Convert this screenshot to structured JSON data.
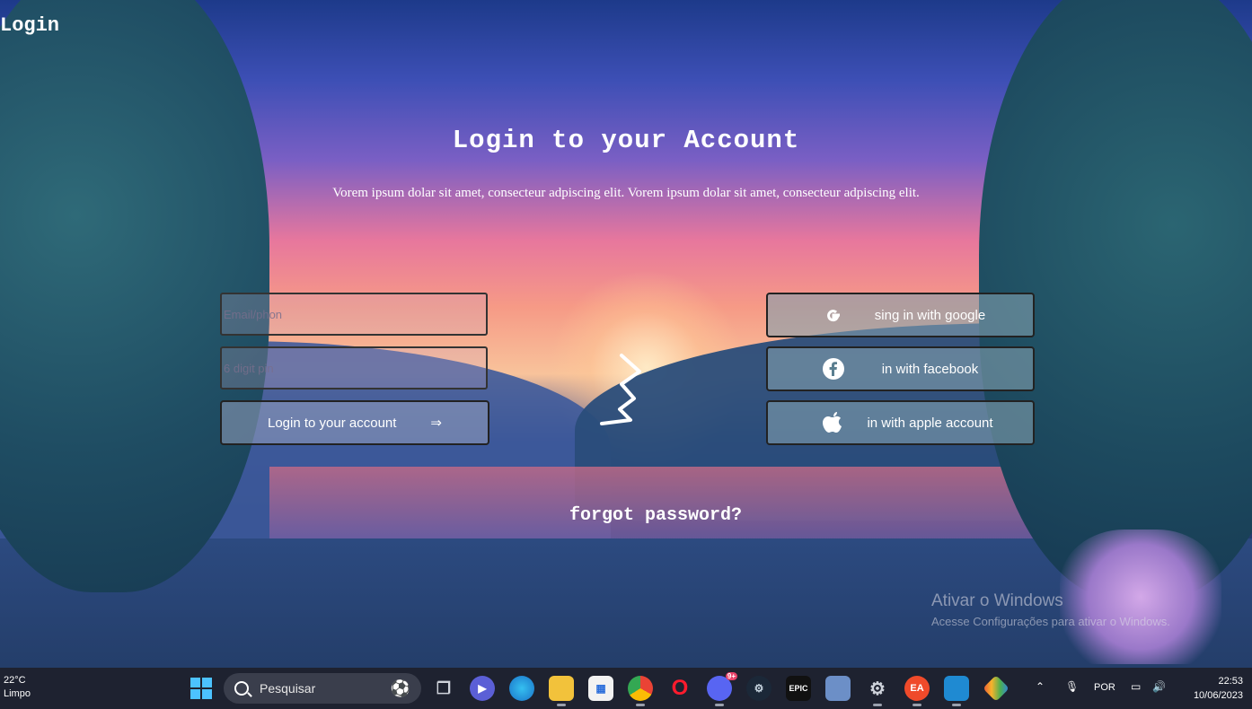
{
  "header": {
    "corner_title": "Login"
  },
  "main": {
    "title": "Login to your Account",
    "subtitle": "Vorem ipsum dolar sit amet, consecteur adpiscing elit. Vorem ipsum dolar sit amet, consecteur adpiscing elit.",
    "email_placeholder": "Email/phon",
    "pin_placeholder": "6 digit pin",
    "login_button_label": "Login to your account",
    "login_arrow": "⇒",
    "forgot_password": "forgot password?"
  },
  "social": {
    "google_label": "sing in with google",
    "facebook_label": "in with facebook",
    "apple_label": "in with apple account"
  },
  "watermark": {
    "line1": "Ativar o Windows",
    "line2": "Acesse Configurações para ativar o Windows."
  },
  "taskbar": {
    "weather_temp": "22°C",
    "weather_desc": "Limpo",
    "search_placeholder": "Pesquisar",
    "discord_badge": "9+",
    "epic_text": "EPIC",
    "ea_text": "EA",
    "language": "POR",
    "time": "22:53",
    "date": "10/06/2023"
  },
  "colors": {
    "accent_blue": "#4cc2ff",
    "taskbar_bg": "#1e2230"
  }
}
